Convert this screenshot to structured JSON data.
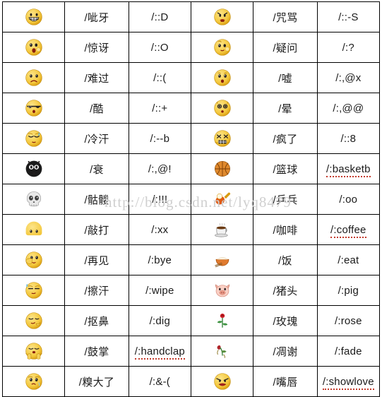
{
  "watermark": "http://blog.csdn.net/lyq8479",
  "table": {
    "columns": [
      "icon",
      "name",
      "code",
      "icon",
      "name",
      "code"
    ],
    "rows": [
      {
        "left": {
          "icon": "grin-teeth-emoticon",
          "name": "/呲牙",
          "code": "/::D"
        },
        "right": {
          "icon": "angry-curse-emoticon",
          "name": "/咒骂",
          "code": "/::-S"
        }
      },
      {
        "left": {
          "icon": "surprised-emoticon",
          "name": "/惊讶",
          "code": "/::O"
        },
        "right": {
          "icon": "doubt-emoticon",
          "name": "/疑问",
          "code": "/:?"
        }
      },
      {
        "left": {
          "icon": "sad-emoticon",
          "name": "/难过",
          "code": "/::("
        },
        "right": {
          "icon": "shush-emoticon",
          "name": "/嘘",
          "code": "/:,@x"
        }
      },
      {
        "left": {
          "icon": "cool-sunglasses-emoticon",
          "name": "/酷",
          "code": "/::+"
        },
        "right": {
          "icon": "dizzy-emoticon",
          "name": "/晕",
          "code": "/:,@@"
        }
      },
      {
        "left": {
          "icon": "cold-sweat-emoticon",
          "name": "/冷汗",
          "code": "/:--b"
        },
        "right": {
          "icon": "crazy-emoticon",
          "name": "/疯了",
          "code": "/::8"
        }
      },
      {
        "left": {
          "icon": "bat-decline-emoticon",
          "name": "/衰",
          "code": "/:,@!"
        },
        "right": {
          "icon": "basketball-icon",
          "name": "/篮球",
          "code": "/:basketb"
        }
      },
      {
        "left": {
          "icon": "skull-emoticon",
          "name": "/骷髅",
          "code": "/:!!!"
        },
        "right": {
          "icon": "pingpong-icon",
          "name": "/乒乓",
          "code": "/:oo"
        }
      },
      {
        "left": {
          "icon": "knock-hammer-emoticon",
          "name": "/敲打",
          "code": "/:xx"
        },
        "right": {
          "icon": "coffee-cup-icon",
          "name": "/咖啡",
          "code": "/:coffee"
        }
      },
      {
        "left": {
          "icon": "goodbye-wave-emoticon",
          "name": "/再见",
          "code": "/:bye"
        },
        "right": {
          "icon": "rice-bowl-icon",
          "name": "/饭",
          "code": "/:eat"
        }
      },
      {
        "left": {
          "icon": "wipe-sweat-emoticon",
          "name": "/擦汗",
          "code": "/:wipe"
        },
        "right": {
          "icon": "pig-head-icon",
          "name": "/猪头",
          "code": "/:pig"
        }
      },
      {
        "left": {
          "icon": "nose-dig-emoticon",
          "name": "/抠鼻",
          "code": "/:dig"
        },
        "right": {
          "icon": "rose-flower-icon",
          "name": "/玫瑰",
          "code": "/:rose"
        }
      },
      {
        "left": {
          "icon": "clap-hands-emoticon",
          "name": "/鼓掌",
          "code": "/:handclap"
        },
        "right": {
          "icon": "wilted-flower-icon",
          "name": "/凋谢",
          "code": "/:fade"
        }
      },
      {
        "left": {
          "icon": "embarrassed-emoticon",
          "name": "/糗大了",
          "code": "/:&-("
        },
        "right": {
          "icon": "lips-kiss-emoticon",
          "name": "/嘴唇",
          "code": "/:showlove"
        }
      }
    ]
  },
  "colors": {
    "face_yellow": "#f5c842",
    "face_yellow_light": "#fde98a",
    "border": "#000000",
    "text": "#1a1a1a",
    "squiggle_red": "#c23a2b",
    "watermark_gray": "#cfcfcf"
  }
}
